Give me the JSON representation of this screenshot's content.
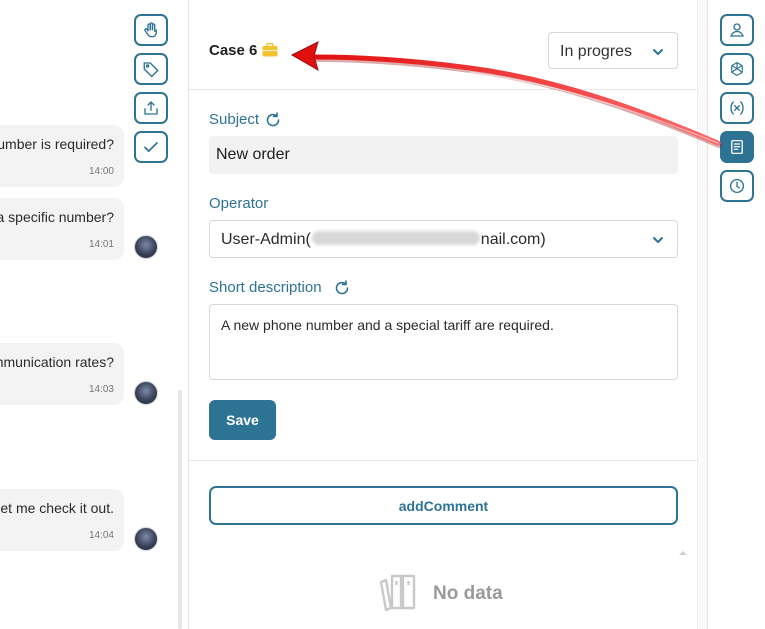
{
  "chat": {
    "messages": [
      {
        "text": "umber is required?",
        "time": "14:00",
        "avatar": false
      },
      {
        "text": "a specific number?",
        "time": "14:01",
        "avatar": true
      },
      {
        "text": "nmunication rates?",
        "time": "14:03",
        "avatar": true
      },
      {
        "text": "et me check it out.",
        "time": "14:04",
        "avatar": true
      }
    ],
    "tools": [
      "hand-icon",
      "tag-icon",
      "share-upload-icon",
      "check-icon"
    ]
  },
  "case": {
    "title": "Case 6",
    "icon": "briefcase-icon",
    "status": "In progres"
  },
  "form": {
    "subject_label": "Subject",
    "subject_value": "New order",
    "operator_label": "Operator",
    "operator_prefix": "User-Admin(",
    "operator_suffix": "nail.com)",
    "description_label": "Short description",
    "description_value": "A new phone number and a special tariff are required.",
    "save_label": "Save"
  },
  "comments": {
    "add_label": "addComment",
    "empty_text": "No data"
  },
  "rail": {
    "items": [
      "user-icon",
      "openai-icon",
      "variable-icon",
      "notes-icon",
      "clock-icon"
    ],
    "active_index": 3
  },
  "colors": {
    "accent": "#2d7394",
    "annotation_arrow": "#e01010",
    "case_icon": "#f2c230"
  }
}
